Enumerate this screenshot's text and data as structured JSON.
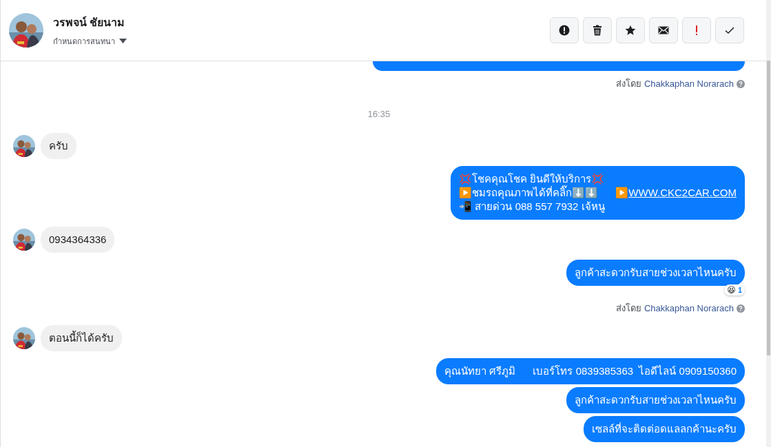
{
  "header": {
    "name": "วรพจน์ ชัยนาม",
    "subtitle": "กำหนดการสนทนา"
  },
  "toolbar": [
    {
      "kind": "report"
    },
    {
      "kind": "delete"
    },
    {
      "kind": "star"
    },
    {
      "kind": "mail"
    },
    {
      "kind": "important"
    },
    {
      "kind": "done"
    }
  ],
  "messages": [
    {
      "kind": "hidden_outgoing"
    },
    {
      "kind": "sender_note",
      "prefix": "ส่งโดย",
      "sender": "Chakkaphan Norarach"
    },
    {
      "kind": "timestamp",
      "text": "16:35"
    },
    {
      "kind": "incoming",
      "lines": [
        [
          {
            "text": "ครับ",
            "kind": "text"
          }
        ]
      ]
    },
    {
      "kind": "outgoing",
      "lines": [
        [
          {
            "text": "💢โชคคุณโชค ยินดีให้บริการ💢",
            "kind": "text"
          }
        ],
        [
          {
            "text": "▶️ชมรถคุณภาพได้ที่คลิ๊ก⬇️⬇️      ▶️",
            "kind": "text"
          },
          {
            "text": "WWW.CKC2CAR.COM",
            "kind": "link"
          }
        ],
        [
          {
            "text": "📲 สายด่วน 088 557 7932 เจ้หนู",
            "kind": "text"
          }
        ]
      ]
    },
    {
      "kind": "incoming",
      "lines": [
        [
          {
            "text": "0934364336",
            "kind": "text"
          }
        ]
      ]
    },
    {
      "kind": "outgoing",
      "lines": [
        [
          {
            "text": "ลูกค้าสะดวกรับสายช่วงเวลาไหนครับ",
            "kind": "text"
          }
        ]
      ],
      "reaction": {
        "emoji": "😆",
        "count": "1"
      }
    },
    {
      "kind": "sender_note",
      "prefix": "ส่งโดย",
      "sender": "Chakkaphan Norarach"
    },
    {
      "kind": "incoming",
      "lines": [
        [
          {
            "text": "ตอนนี้ก็ได้ครับ",
            "kind": "text"
          }
        ]
      ]
    },
    {
      "kind": "outgoing",
      "lines": [
        [
          {
            "text": "คุณนัทยา ศรีภูมิ      เบอร์โทร 0839385363  ไอดีไลน์ 0909150360",
            "kind": "text"
          }
        ]
      ]
    },
    {
      "kind": "outgoing",
      "lines": [
        [
          {
            "text": "ลูกค้าสะดวกรับสายช่วงเวลาไหนครับ",
            "kind": "text"
          }
        ]
      ]
    },
    {
      "kind": "outgoing",
      "lines": [
        [
          {
            "text": "เซลล์ที่จะติดต่อดแลลกค้านะครับ",
            "kind": "text"
          }
        ]
      ]
    }
  ]
}
